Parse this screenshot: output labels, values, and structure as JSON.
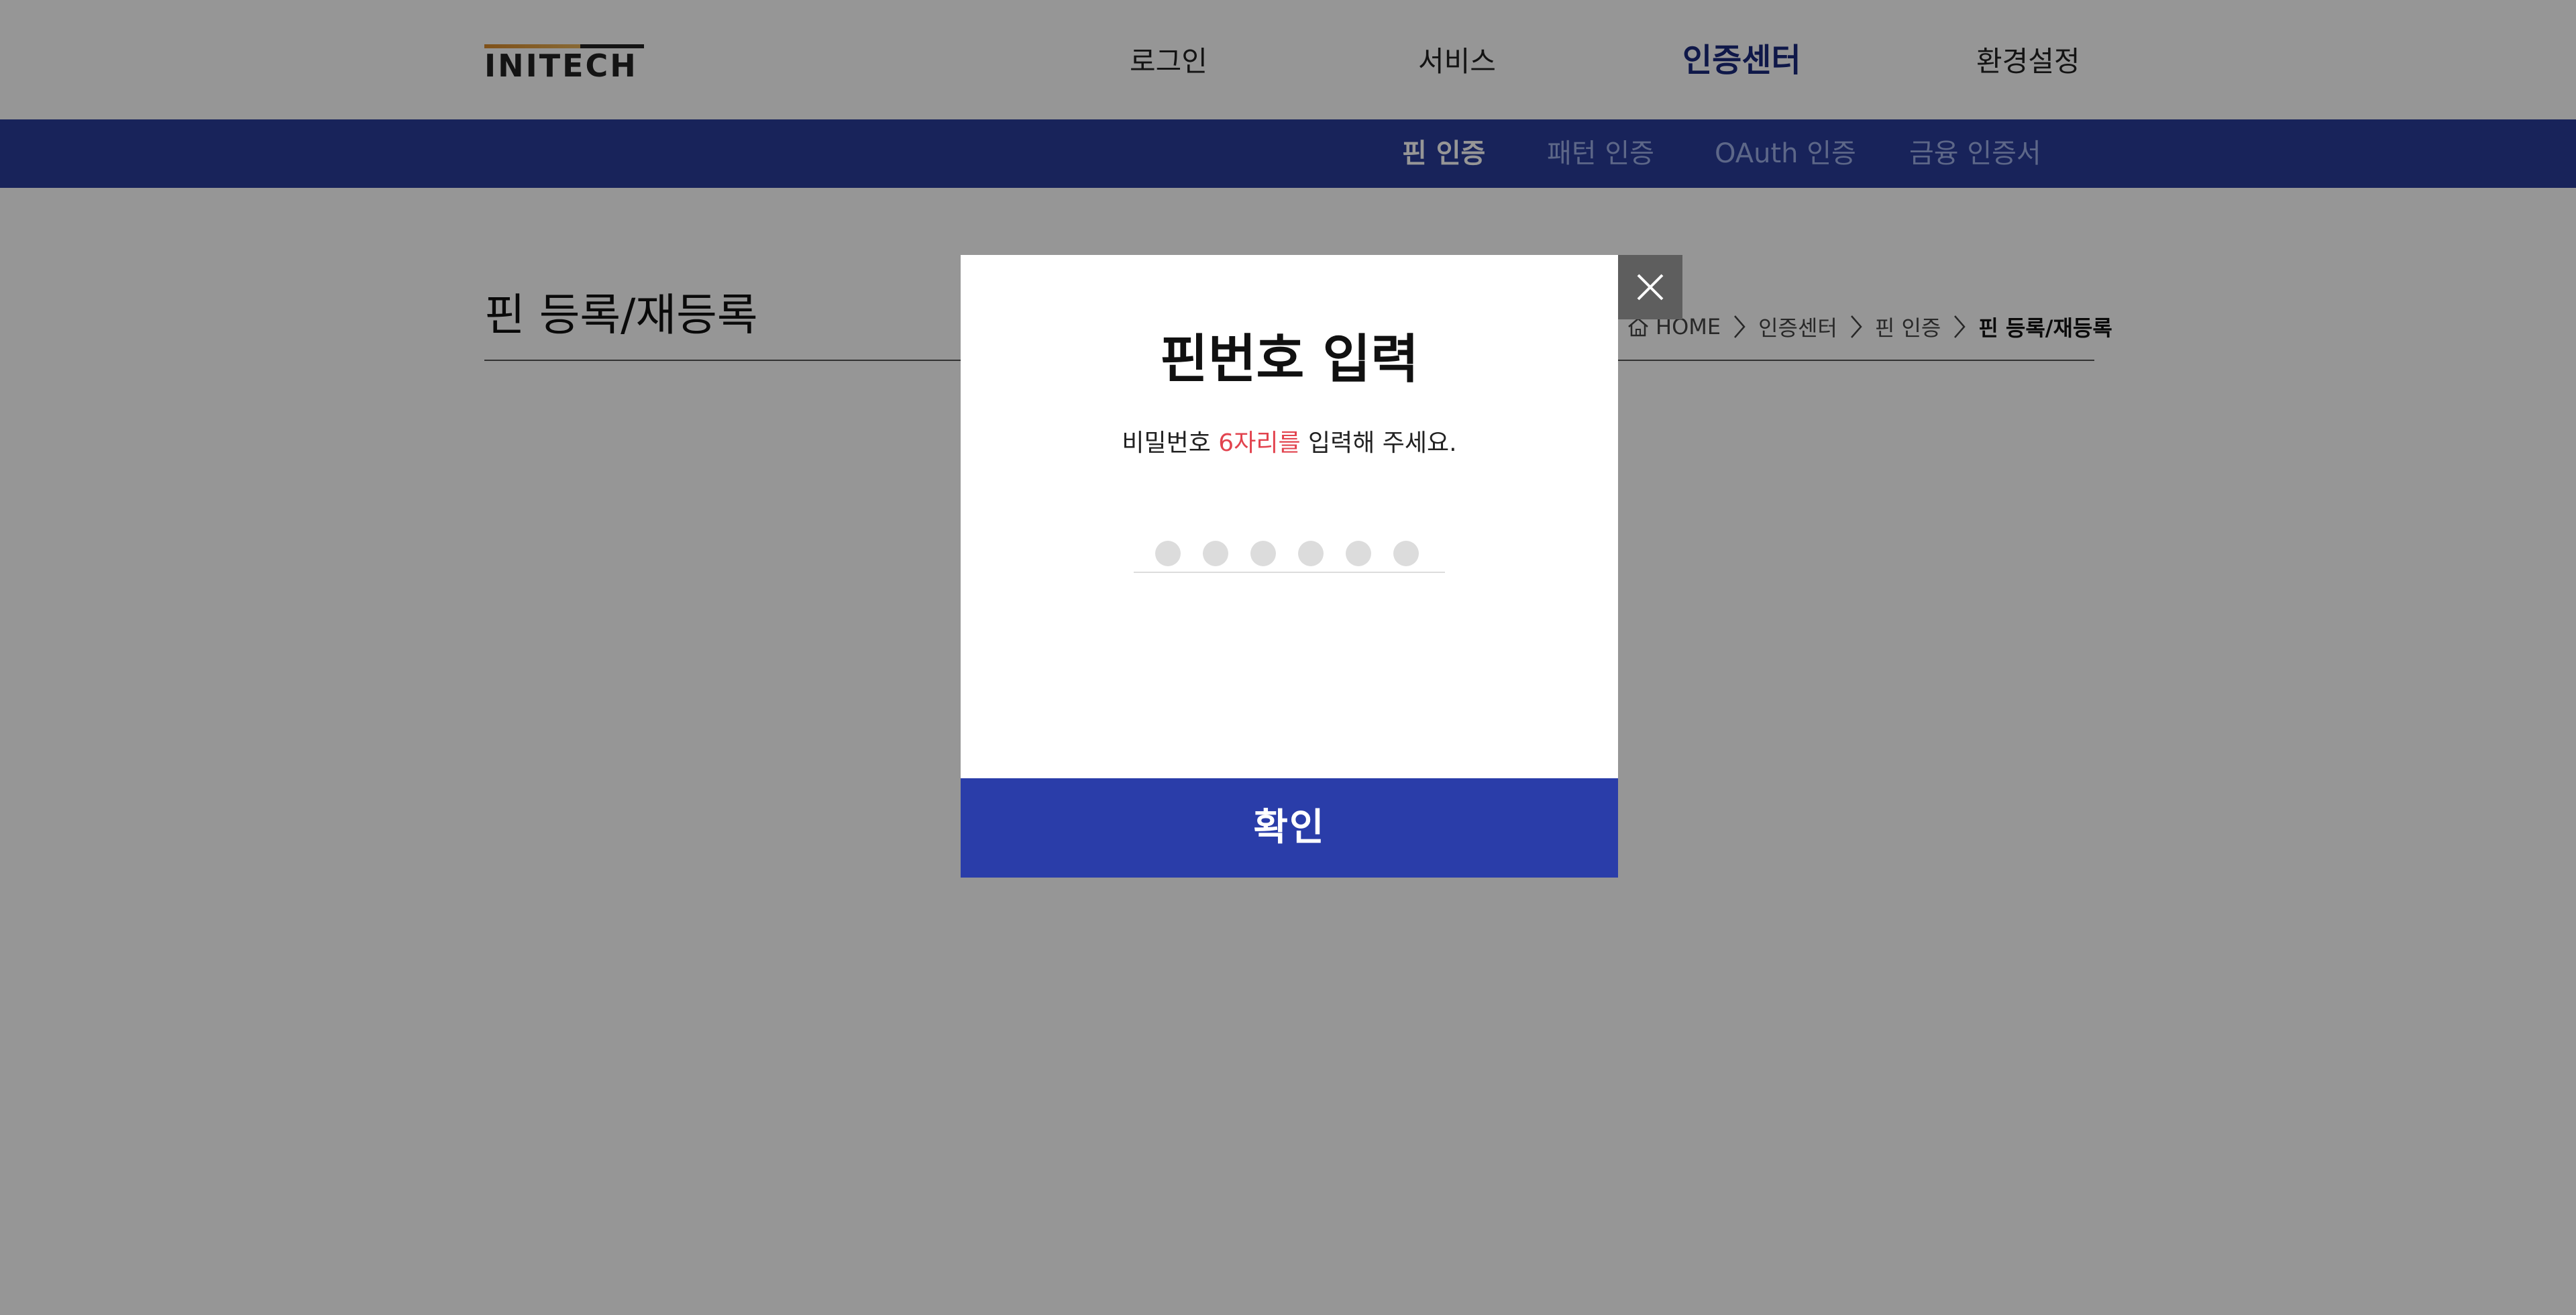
{
  "header": {
    "logo_text": "INITECH",
    "nav": [
      {
        "label": "로그인",
        "active": false
      },
      {
        "label": "서비스",
        "active": false
      },
      {
        "label": "인증센터",
        "active": true
      },
      {
        "label": "환경설정",
        "active": false
      }
    ]
  },
  "subnav": {
    "items": [
      {
        "label": "핀 인증",
        "active": true
      },
      {
        "label": "패턴 인증",
        "active": false
      },
      {
        "label": "OAuth 인증",
        "active": false
      },
      {
        "label": "금융 인증서",
        "active": false
      }
    ]
  },
  "page": {
    "title": "핀 등록/재등록",
    "breadcrumb": {
      "home": "HOME",
      "level1": "인증센터",
      "level2": "핀 인증",
      "current": "핀 등록/재등록"
    }
  },
  "modal": {
    "title": "핀번호 입력",
    "desc_before": "비밀번호 ",
    "desc_highlight": "6자리를",
    "desc_after": " 입력해 주세요.",
    "pin_length": 6,
    "pin_filled": 0,
    "confirm_label": "확인",
    "close_icon": "close-icon"
  },
  "colors": {
    "brand_blue": "#2a3da9",
    "nav_active": "#1b2a7c",
    "highlight_red": "#e2434e",
    "overlay": "rgba(0,0,0,0.41)"
  }
}
